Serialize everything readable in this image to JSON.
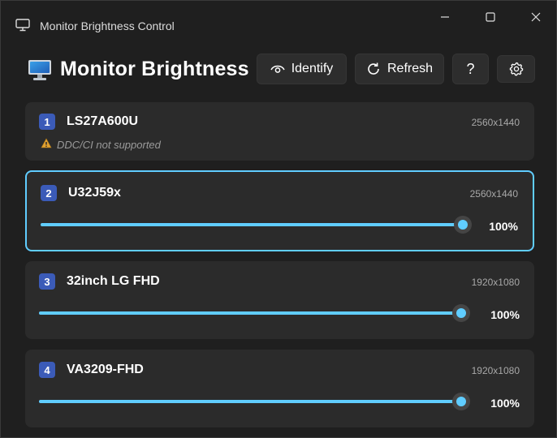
{
  "window": {
    "title": "Monitor Brightness Control"
  },
  "header": {
    "title": "Monitor Brightness",
    "identify_label": "Identify",
    "refresh_label": "Refresh",
    "help_label": "?"
  },
  "colors": {
    "accent": "#60cdff",
    "badge": "#3b5bb8",
    "card": "#2b2b2b",
    "background": "#1f1f1f",
    "warning": "#e0a030"
  },
  "monitors": [
    {
      "number": "1",
      "name": "LS27A600U",
      "resolution": "2560x1440",
      "warning": "DDC/CI not supported"
    },
    {
      "number": "2",
      "name": "U32J59x",
      "resolution": "2560x1440",
      "brightness": 100,
      "brightness_label": "100%",
      "selected": true
    },
    {
      "number": "3",
      "name": "32inch LG FHD",
      "resolution": "1920x1080",
      "brightness": 100,
      "brightness_label": "100%"
    },
    {
      "number": "4",
      "name": "VA3209-FHD",
      "resolution": "1920x1080",
      "brightness": 100,
      "brightness_label": "100%"
    }
  ],
  "icons": {
    "app": "monitor-icon",
    "minimize": "minimize-icon",
    "maximize": "maximize-icon",
    "close": "close-icon",
    "identify": "eye-icon",
    "refresh": "refresh-icon",
    "settings": "gear-icon",
    "warning": "warning-icon"
  }
}
